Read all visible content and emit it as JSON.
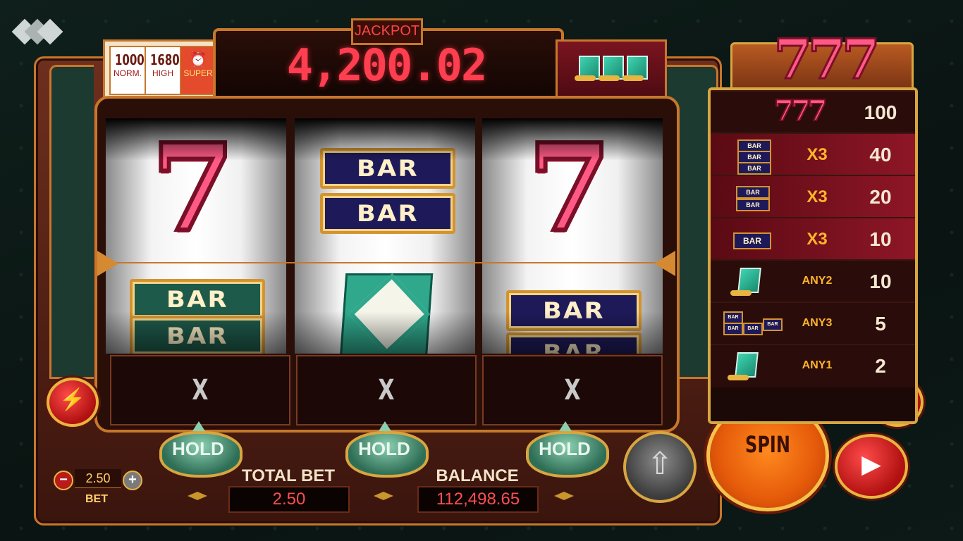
{
  "jackpot": {
    "label": "JACKPOT",
    "value": "4,200.02"
  },
  "modes": [
    {
      "value": "1000",
      "label": "NORM."
    },
    {
      "value": "1680",
      "label": "HIGH"
    },
    {
      "value": "",
      "label": "SUPER"
    }
  ],
  "reels": [
    {
      "top": "7",
      "bottom": [
        "BAR",
        "BAR"
      ]
    },
    {
      "top": [
        "BAR",
        "BAR"
      ],
      "bottom": "card"
    },
    {
      "top": "7",
      "bottom": [
        "BAR",
        "BAR"
      ]
    }
  ],
  "reel_results": [
    "X",
    "X",
    "X"
  ],
  "hold_buttons": [
    "HOLD",
    "HOLD",
    "HOLD"
  ],
  "bet": {
    "value": "2.50",
    "label": "BET",
    "minus": "−",
    "plus": "+"
  },
  "total_bet": {
    "label": "TOTAL BET",
    "value": "2.50"
  },
  "balance": {
    "label": "BALANCE",
    "value": "112,498.65"
  },
  "spin": {
    "label": "SPIN"
  },
  "paytable": {
    "logo": "777",
    "rows": [
      {
        "symbol": "777",
        "multiplier": "",
        "payout": "100"
      },
      {
        "symbol": "3xBAR",
        "multiplier": "X3",
        "payout": "40"
      },
      {
        "symbol": "2xBAR",
        "multiplier": "X3",
        "payout": "20"
      },
      {
        "symbol": "BAR",
        "multiplier": "X3",
        "payout": "10"
      },
      {
        "symbol": "card",
        "multiplier": "ANY2",
        "payout": "10"
      },
      {
        "symbol": "bars",
        "multiplier": "ANY3",
        "payout": "5"
      },
      {
        "symbol": "card",
        "multiplier": "ANY1",
        "payout": "2"
      }
    ]
  },
  "icons": {
    "bolt": "lightning-icon",
    "menu": "menu-list-icon",
    "autoplay": "autoplay-icon",
    "play": "play-circle-icon",
    "up": "arrow-up-icon"
  },
  "colors": {
    "accent": "#c7772c",
    "jackpot": "#ff3e4f",
    "spin": "#ff8a1e"
  }
}
